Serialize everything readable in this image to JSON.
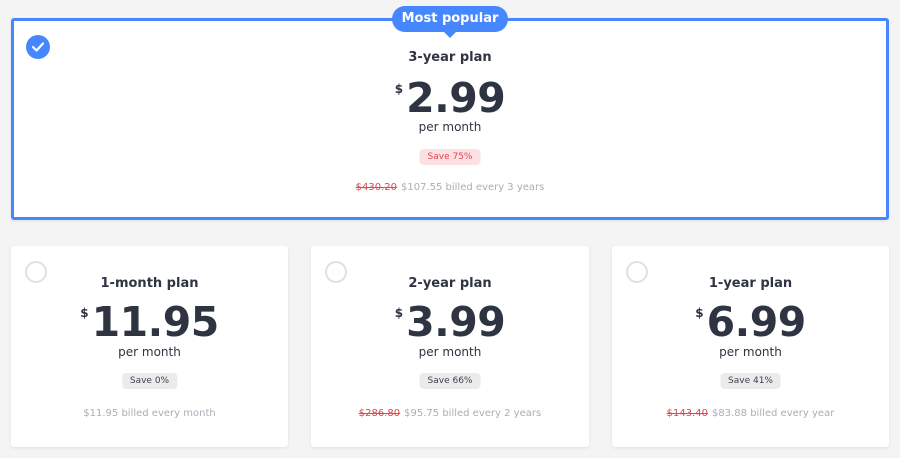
{
  "badge": {
    "label": "Most popular"
  },
  "featured": {
    "plan": "3-year plan",
    "currency": "$",
    "price": "2.99",
    "per": "per month",
    "save": "Save 75%",
    "old_price": "$430.20",
    "billing": "$107.55 billed every 3 years",
    "selected": true
  },
  "plans": [
    {
      "plan": "1-month plan",
      "currency": "$",
      "price": "11.95",
      "per": "per month",
      "save": "Save 0%",
      "old_price": "",
      "billing": "$11.95 billed every month",
      "selected": false
    },
    {
      "plan": "2-year plan",
      "currency": "$",
      "price": "3.99",
      "per": "per month",
      "save": "Save 66%",
      "old_price": "$286.80",
      "billing": "$95.75 billed every 2 years",
      "selected": false
    },
    {
      "plan": "1-year plan",
      "currency": "$",
      "price": "6.99",
      "per": "per month",
      "save": "Save 41%",
      "old_price": "$143.40",
      "billing": "$83.88 billed every year",
      "selected": false
    }
  ],
  "colors": {
    "accent": "#4687ff",
    "strike": "#e0464f",
    "save_highlight_bg": "#fde0e3",
    "save_bg": "#ebebeb",
    "page_bg": "#f4f4f4",
    "text_dark": "#2e3442",
    "text_muted": "#a9aeb6"
  },
  "icons": {
    "selected": "checkmark-icon",
    "unselected": "radio-empty-icon"
  }
}
